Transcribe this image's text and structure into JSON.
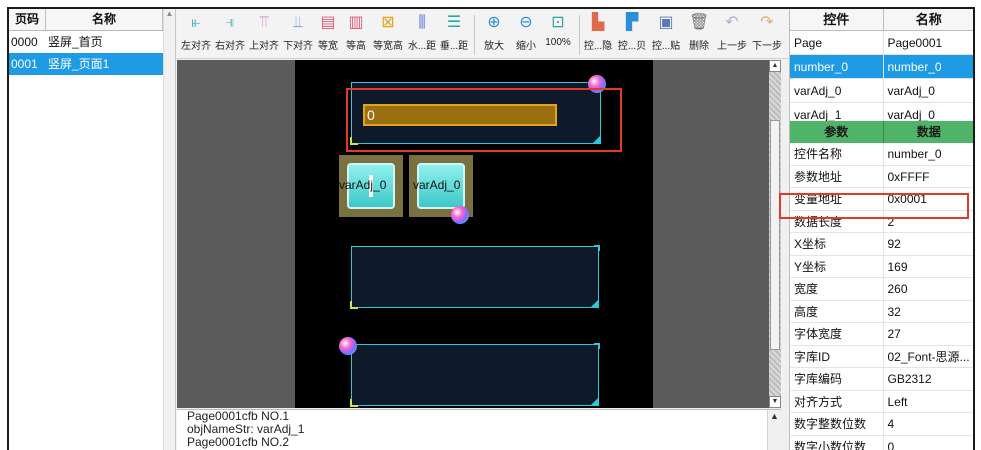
{
  "page_list": {
    "headers": [
      "页码",
      "名称"
    ],
    "rows": [
      {
        "num": "0000",
        "name": "竖屏_首页"
      },
      {
        "num": "0001",
        "name": "竖屏_页面1"
      }
    ]
  },
  "toolbar": {
    "left_align": "左对齐",
    "right_align": "右对齐",
    "top_align": "上对齐",
    "bottom_align": "下对齐",
    "equal_width": "等宽",
    "equal_height": "等高",
    "equal_wh": "等宽高",
    "h_spacing": "水...距",
    "v_spacing": "垂...距",
    "zoom_in": "放大",
    "zoom_out": "缩小",
    "zoom_100": "100%",
    "ctrl_hide": "控...隐",
    "ctrl_copy": "控...贝",
    "ctrl_paste": "控...贴",
    "delete": "删除",
    "undo": "上一步",
    "redo": "下一步"
  },
  "canvas": {
    "number_value": "0",
    "var_label_1": "varAdj_0",
    "var_label_2": "varAdj_0"
  },
  "log": {
    "lines": [
      "Page0001cfb NO.1",
      "objNameStr: varAdj_1",
      "Page0001cfb NO.2"
    ]
  },
  "controls": {
    "headers": [
      "控件",
      "名称"
    ],
    "rows": [
      {
        "type": "Page",
        "name": "Page0001"
      },
      {
        "type": "number_0",
        "name": "number_0"
      },
      {
        "type": "varAdj_0",
        "name": "varAdj_0"
      },
      {
        "type": "varAdj_1",
        "name": "varAdj_0"
      }
    ]
  },
  "params": {
    "headers": [
      "参数",
      "数据"
    ],
    "rows": [
      {
        "key": "控件名称",
        "val": "number_0"
      },
      {
        "key": "参数地址",
        "val": "0xFFFF"
      },
      {
        "key": "变量地址",
        "val": "0x0001"
      },
      {
        "key": "数据长度",
        "val": "2"
      },
      {
        "key": "X坐标",
        "val": "92"
      },
      {
        "key": "Y坐标",
        "val": "169"
      },
      {
        "key": "宽度",
        "val": "260"
      },
      {
        "key": "高度",
        "val": "32"
      },
      {
        "key": "字体宽度",
        "val": "27"
      },
      {
        "key": "字库ID",
        "val": "02_Font-思源..."
      },
      {
        "key": "字库编码",
        "val": "GB2312"
      },
      {
        "key": "对齐方式",
        "val": "Left"
      },
      {
        "key": "数字整数位数",
        "val": "4"
      },
      {
        "key": "数字小数位数",
        "val": "0"
      }
    ]
  },
  "colors": {
    "selection_blue": "#1e9be4",
    "param_header_green": "#4fb36a",
    "highlight_red": "#e23a2a",
    "panel_cyan": "#2ec9d6"
  }
}
